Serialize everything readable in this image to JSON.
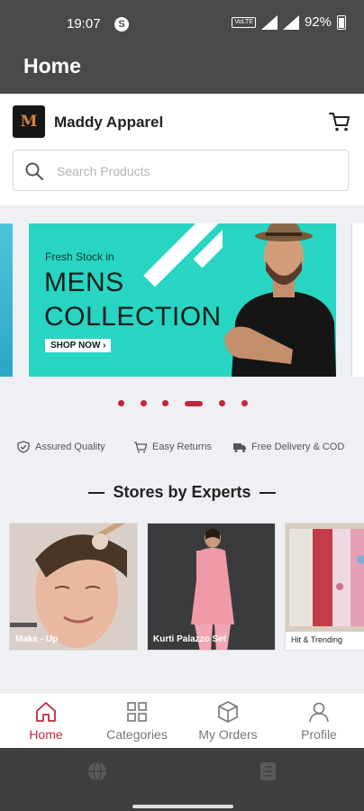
{
  "status_bar": {
    "time": "19:07",
    "s_badge": "S",
    "volte": "VoLTE",
    "battery": "92%"
  },
  "app_bar": {
    "title": "Home"
  },
  "store": {
    "logo_letter": "M",
    "name": "Maddy Apparel"
  },
  "search": {
    "placeholder": "Search Products",
    "value": ""
  },
  "banner": {
    "subtitle": "Fresh Stock in",
    "title_line1": "MENS",
    "title_line2": "COLLECTION",
    "cta": "SHOP NOW ›",
    "total_slides": 6,
    "active_slide": 4
  },
  "features": [
    {
      "label": "Assured Quality",
      "icon": "shield-check-icon"
    },
    {
      "label": "Easy Returns",
      "icon": "cart-return-icon"
    },
    {
      "label": "Free Delivery & COD",
      "icon": "truck-icon"
    }
  ],
  "stores_section": {
    "title": "Stores by Experts",
    "cards": [
      {
        "label": "Make - Up"
      },
      {
        "label": "Kurti Palazzo Set"
      },
      {
        "label": "Hit & Trending"
      }
    ]
  },
  "bottom_nav": {
    "items": [
      {
        "label": "Home",
        "icon": "home-icon",
        "active": true
      },
      {
        "label": "Categories",
        "icon": "grid-icon",
        "active": false
      },
      {
        "label": "My Orders",
        "icon": "box-icon",
        "active": false
      },
      {
        "label": "Profile",
        "icon": "user-icon",
        "active": false
      }
    ]
  },
  "colors": {
    "accent": "#c0283d",
    "banner_bg": "#28d5c2",
    "app_bar": "#4a4a4a"
  }
}
